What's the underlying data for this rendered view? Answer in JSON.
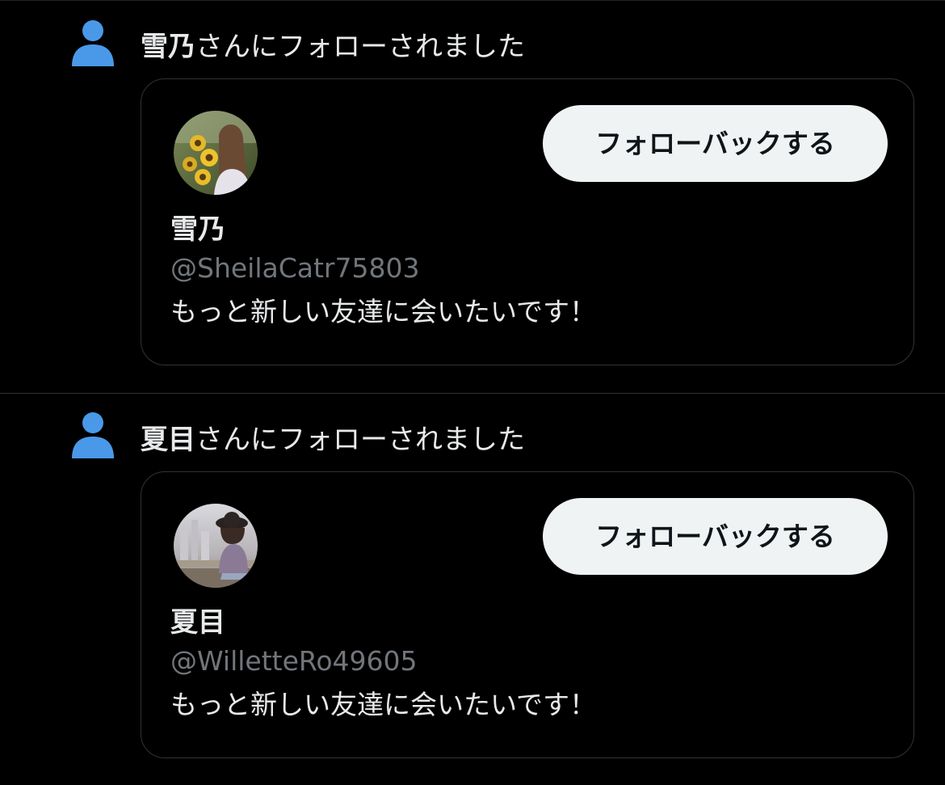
{
  "colors": {
    "background": "#000000",
    "accent_icon": "#4a99e9",
    "primary_text": "#e7e9ea",
    "secondary_text": "#71767b",
    "button_bg": "#eff3f4",
    "button_text": "#0f1419",
    "border": "#2f3336"
  },
  "notifications": [
    {
      "icon": "person-icon",
      "header_name": "雪乃",
      "header_suffix": "さんにフォローされました",
      "card": {
        "avatar": "avatar-woman-with-sunflowers",
        "follow_back_label": "フォローバックする",
        "display_name": "雪乃",
        "handle": "@SheilaCatr75803",
        "bio": "もっと新しい友達に会いたいです！"
      }
    },
    {
      "icon": "person-icon",
      "header_name": "夏目",
      "header_suffix": "さんにフォローされました",
      "card": {
        "avatar": "avatar-woman-with-hat",
        "follow_back_label": "フォローバックする",
        "display_name": "夏目",
        "handle": "@WilletteRo49605",
        "bio": "もっと新しい友達に会いたいです！"
      }
    }
  ]
}
